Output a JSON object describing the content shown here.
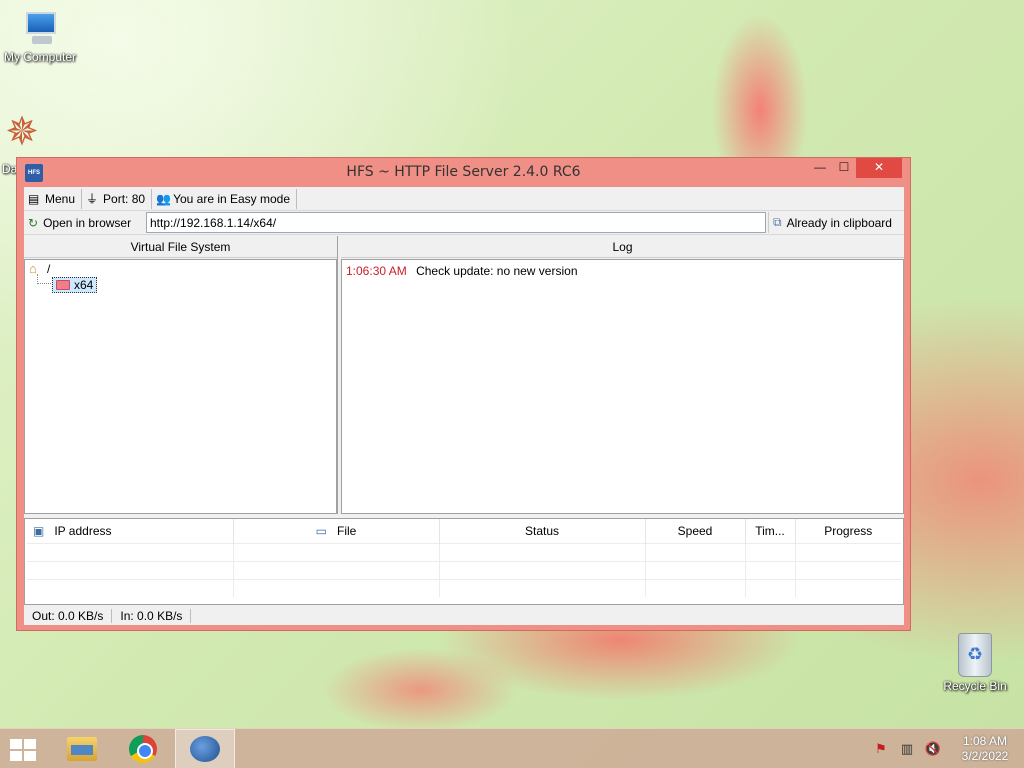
{
  "desktop": {
    "icons": [
      {
        "label": "My Computer"
      },
      {
        "label": "Da"
      },
      {
        "label": "Recycle Bin"
      }
    ]
  },
  "window": {
    "app_icon_text": "HFS",
    "title": "HFS ~ HTTP File Server 2.4.0 RC6",
    "controls": {
      "minimize": "—",
      "maximize": "☐",
      "close": "✕"
    }
  },
  "toolbar": {
    "menu_label": "Menu",
    "port_label": "Port: 80",
    "mode_label": "You are in Easy mode"
  },
  "urlbar": {
    "open_label": "Open in browser",
    "url_value": "http://192.168.1.14/x64/",
    "clipboard_label": "Already in clipboard"
  },
  "vfs": {
    "header": "Virtual File System",
    "root": "/",
    "items": [
      {
        "label": "x64"
      }
    ]
  },
  "log": {
    "header": "Log",
    "entries": [
      {
        "time": "1:06:30 AM",
        "text": "Check update: no new version"
      }
    ]
  },
  "connections": {
    "columns": [
      "IP address",
      "File",
      "Status",
      "Speed",
      "Tim...",
      "Progress"
    ]
  },
  "statusbar": {
    "out": "Out: 0.0 KB/s",
    "in": "In: 0.0 KB/s"
  },
  "taskbar": {
    "clock_time": "1:08 AM",
    "clock_date": "3/2/2022"
  },
  "colors": {
    "title_bar": "#f08f86",
    "close_button": "#e04a43",
    "log_time": "#c8202a"
  }
}
